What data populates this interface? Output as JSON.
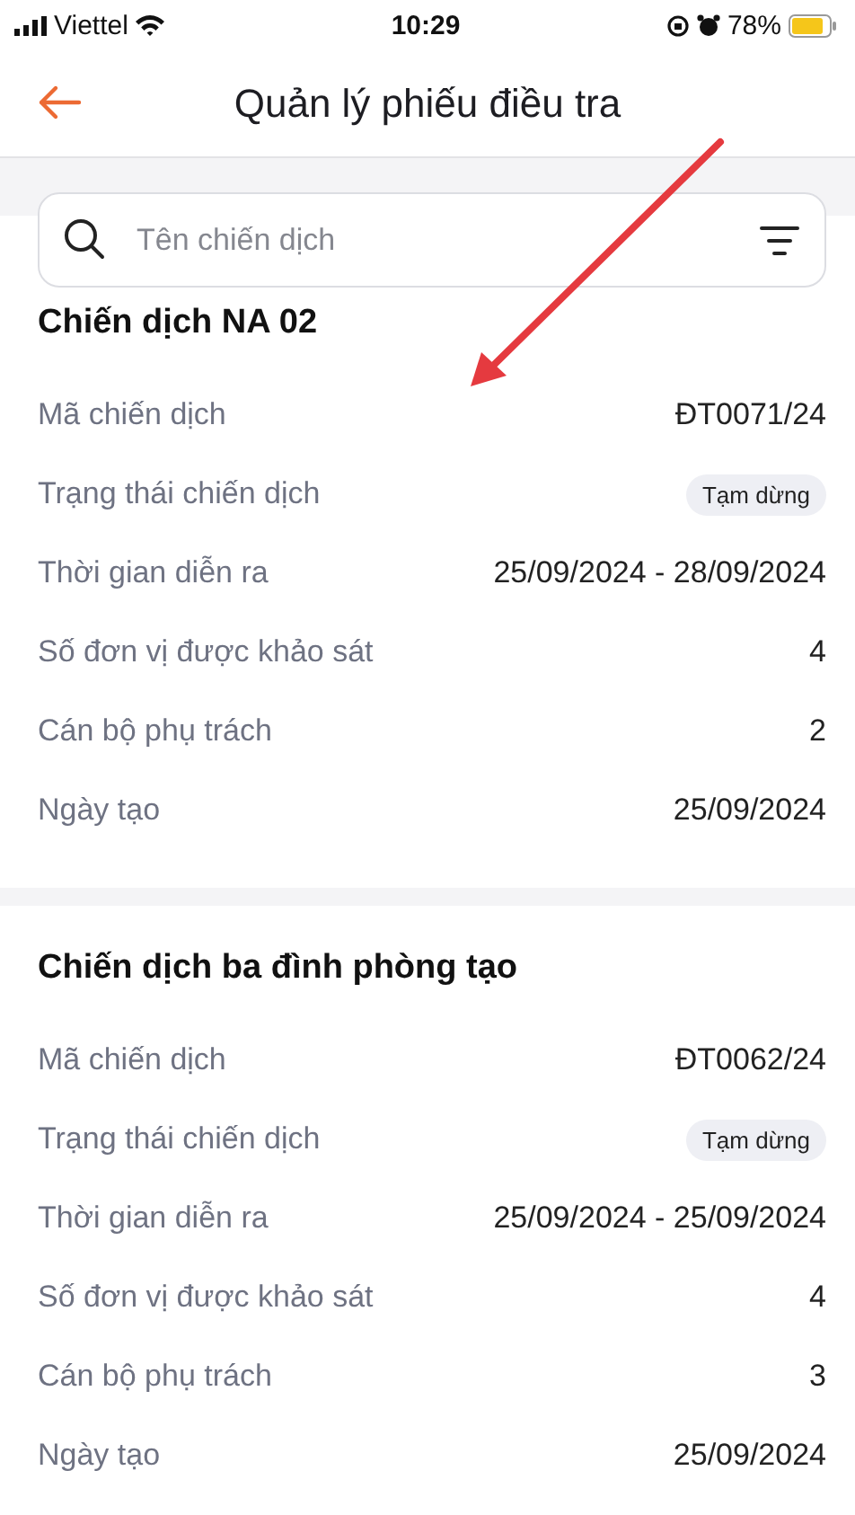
{
  "status_bar": {
    "carrier": "Viettel",
    "time": "10:29",
    "battery": "78%"
  },
  "header": {
    "title": "Quản lý phiếu điều tra"
  },
  "search": {
    "placeholder": "Tên chiến dịch"
  },
  "campaigns": [
    {
      "title": "Chiến dịch NA 02",
      "fields": [
        {
          "label": "Mã chiến dịch",
          "value": "ĐT0071/24",
          "kind": "text"
        },
        {
          "label": "Trạng thái chiến dịch",
          "value": "Tạm dừng",
          "kind": "badge"
        },
        {
          "label": "Thời gian diễn ra",
          "value": "25/09/2024 - 28/09/2024",
          "kind": "text"
        },
        {
          "label": "Số đơn vị được khảo sát",
          "value": "4",
          "kind": "text"
        },
        {
          "label": "Cán bộ phụ trách",
          "value": "2",
          "kind": "text"
        },
        {
          "label": "Ngày tạo",
          "value": "25/09/2024",
          "kind": "text"
        }
      ]
    },
    {
      "title": "Chiến dịch ba đình phòng tạo",
      "fields": [
        {
          "label": "Mã chiến dịch",
          "value": "ĐT0062/24",
          "kind": "text"
        },
        {
          "label": "Trạng thái chiến dịch",
          "value": "Tạm dừng",
          "kind": "badge"
        },
        {
          "label": "Thời gian diễn ra",
          "value": "25/09/2024 - 25/09/2024",
          "kind": "text"
        },
        {
          "label": "Số đơn vị được khảo sát",
          "value": "4",
          "kind": "text"
        },
        {
          "label": "Cán bộ phụ trách",
          "value": "3",
          "kind": "text"
        },
        {
          "label": "Ngày tạo",
          "value": "25/09/2024",
          "kind": "text"
        }
      ]
    }
  ]
}
